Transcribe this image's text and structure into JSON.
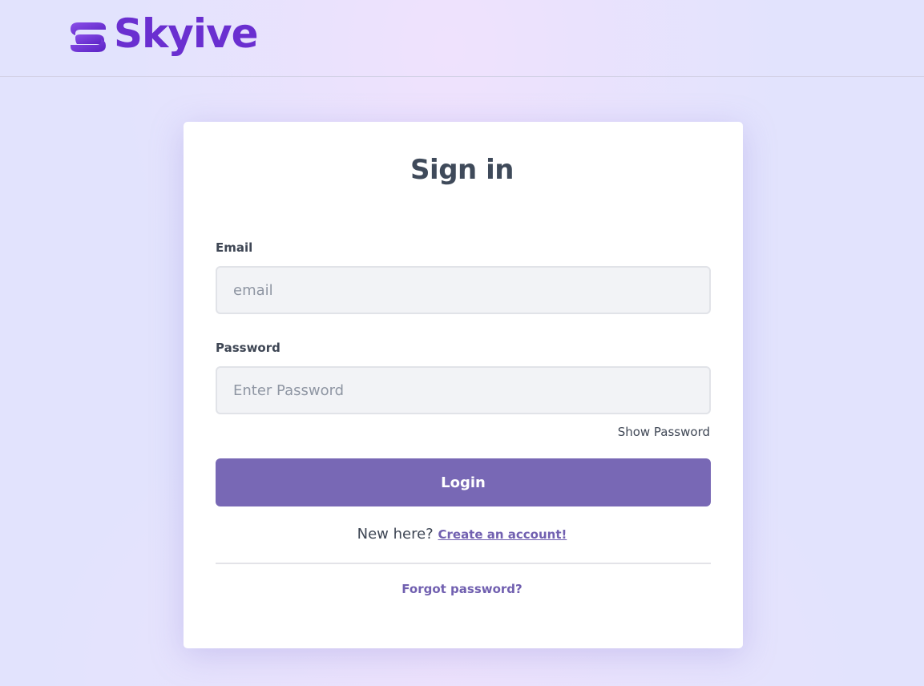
{
  "brand": {
    "name": "Skyive",
    "color": "#6a2fd0"
  },
  "form": {
    "title": "Sign in",
    "email_label": "Email",
    "email_placeholder": "email",
    "password_label": "Password",
    "password_placeholder": "Enter Password",
    "show_password": "Show Password",
    "login_label": "Login",
    "new_here": "New here?",
    "create_account": "Create an account!",
    "forgot_password": "Forgot password?"
  },
  "colors": {
    "accent": "#7868b5",
    "link": "#7160b0",
    "background": "#e2e3fd"
  }
}
